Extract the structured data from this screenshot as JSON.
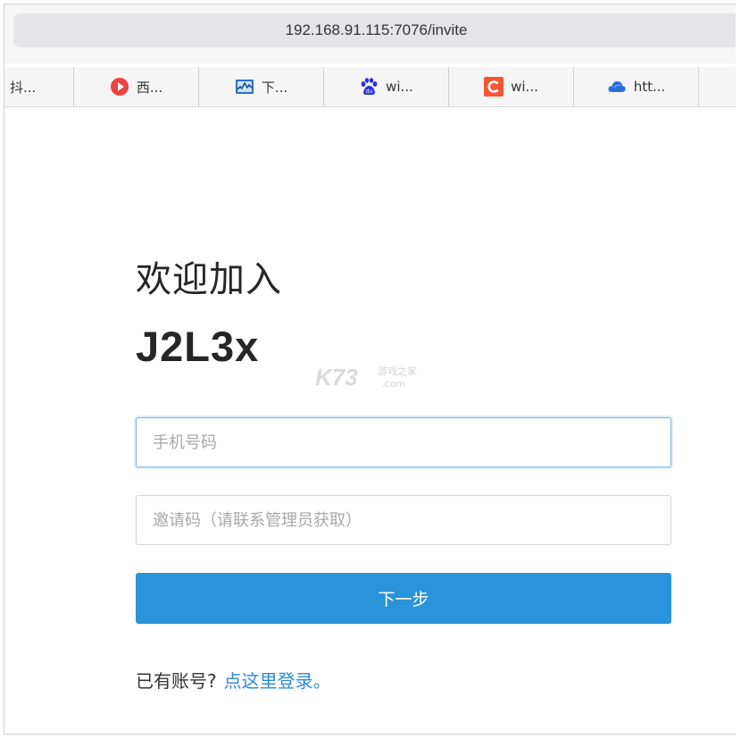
{
  "browser": {
    "url": "192.168.91.115:7076/invite"
  },
  "tabs": [
    {
      "label": "抖...",
      "icon": "none"
    },
    {
      "label": "西...",
      "icon": "xigua-icon",
      "color": "#f04142"
    },
    {
      "label": "下...",
      "icon": "monitor-chart-icon",
      "color": "#2a6fc9"
    },
    {
      "label": "wi...",
      "icon": "baidu-paw-icon",
      "color": "#2932e1"
    },
    {
      "label": "wi...",
      "icon": "csdn-c-icon",
      "color": "#fc5531"
    },
    {
      "label": "htt...",
      "icon": "cloud-icon",
      "color": "#2a6de0"
    }
  ],
  "page": {
    "welcome": "欢迎加入",
    "app_name": "J2L3x",
    "watermark": {
      "brand": "K73",
      "subtitle": "游戏之家",
      "domain": ".com"
    },
    "phone_placeholder": "手机号码",
    "invite_placeholder": "邀请码（请联系管理员获取）",
    "next_label": "下一步",
    "has_account": "已有账号?",
    "login_link": "点这里登录。"
  },
  "colors": {
    "primary": "#2b93d9",
    "link": "#2b8ad6",
    "focus_border": "#7fb4e6"
  }
}
